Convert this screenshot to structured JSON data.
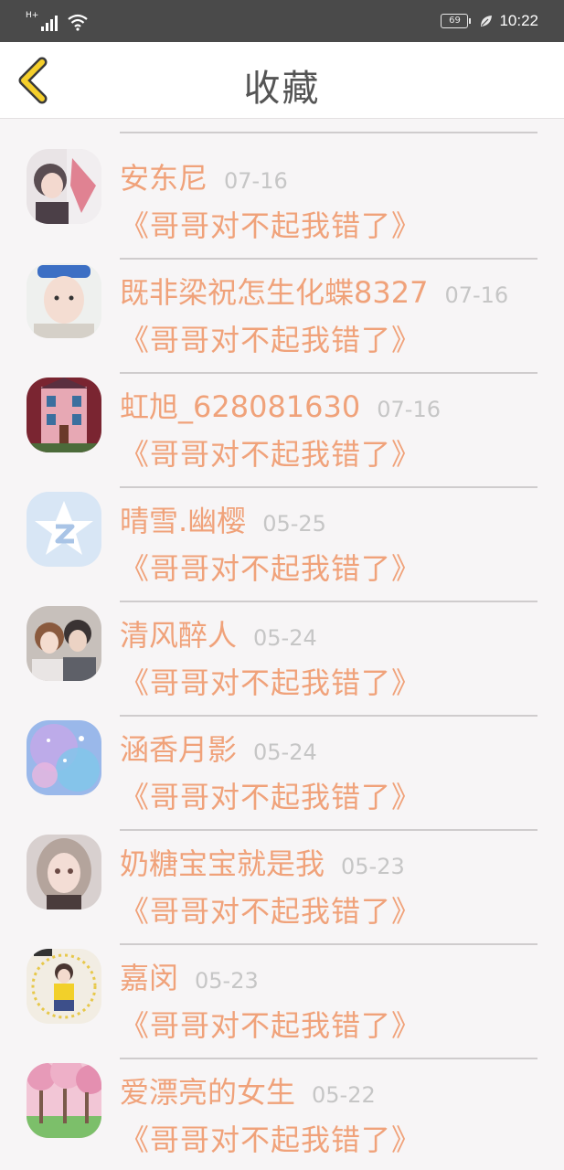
{
  "status_bar": {
    "network": "H+",
    "battery": "69",
    "time": "10:22"
  },
  "header": {
    "title": "收藏"
  },
  "colors": {
    "accent": "#f0a27a",
    "date": "#c6c6c6",
    "back_icon": "#f5cf2b"
  },
  "items": [
    {
      "name": "安东尼",
      "date": "07-16",
      "work": "《哥哥对不起我错了》",
      "avatar": "girl-sketch"
    },
    {
      "name": "既非梁祝怎生化蝶8327",
      "date": "07-16",
      "work": "《哥哥对不起我错了》",
      "avatar": "child-photo"
    },
    {
      "name": "虹旭_628081630",
      "date": "07-16",
      "work": "《哥哥对不起我错了》",
      "avatar": "pink-house"
    },
    {
      "name": "晴雪.幽樱",
      "date": "05-25",
      "work": "《哥哥对不起我错了》",
      "avatar": "qzone-star"
    },
    {
      "name": "清风醉人",
      "date": "05-24",
      "work": "《哥哥对不起我错了》",
      "avatar": "couple-photo"
    },
    {
      "name": "涵香月影",
      "date": "05-24",
      "work": "《哥哥对不起我错了》",
      "avatar": "blue-sparkle"
    },
    {
      "name": "奶糖宝宝就是我",
      "date": "05-23",
      "work": "《哥哥对不起我错了》",
      "avatar": "anime-girl"
    },
    {
      "name": "嘉闵",
      "date": "05-23",
      "work": "《哥哥对不起我错了》",
      "avatar": "yellow-girl"
    },
    {
      "name": "爱漂亮的女生",
      "date": "05-22",
      "work": "《哥哥对不起我错了》",
      "avatar": "cherry-blossom"
    }
  ]
}
